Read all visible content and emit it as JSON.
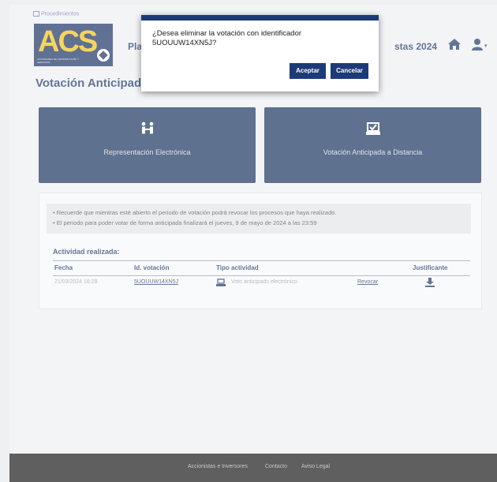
{
  "header": {
    "procedimientos_label": "Procedimientos",
    "logo_text": "ACS",
    "logo_subtext": "ACTIVIDADES DE CONSTRUCCIÓN Y SERVICIOS",
    "title_left_fragment": "Pla",
    "title_right_fragment": "stas 2024"
  },
  "page_title": "Votación Anticipada",
  "tiles": [
    {
      "label": "Representación Electrónica",
      "icon": "handshake-icon"
    },
    {
      "label": "Votación Anticipada a Distancia",
      "icon": "ballot-box-icon"
    }
  ],
  "notice": {
    "line1": "• Recuerde que mientras esté abierto el periodo de votación podrá revocar los procesos que haya realizado.",
    "line2": "• El periodo para poder votar de forma anticipada finalizará el jueves, 9 de mayo de 2024 a las 23:59"
  },
  "activity": {
    "title": "Actividad realizada:",
    "columns": [
      "Fecha",
      "Id. votación",
      "Tipo actividad",
      "Justificante"
    ],
    "rows": [
      {
        "fecha": "21/03/2024 16:28",
        "id": "5UOUUW14XN5J",
        "tipo": "Voto anticipado electrónico",
        "revocar": "Revocar"
      }
    ]
  },
  "footer": {
    "links": [
      "Accionistas e Inversores",
      "Contacto",
      "Aviso Legal"
    ]
  },
  "modal": {
    "message": "¿Desea eliminar la votación con identificador 5UOUUW14XN5J?",
    "accept_label": "Aceptar",
    "cancel_label": "Cancelar"
  },
  "colors": {
    "navy": "#19345e",
    "modal_accent": "#1d3a78",
    "logo_yellow": "#f3c318",
    "footer_bg": "#1a1a1b"
  }
}
